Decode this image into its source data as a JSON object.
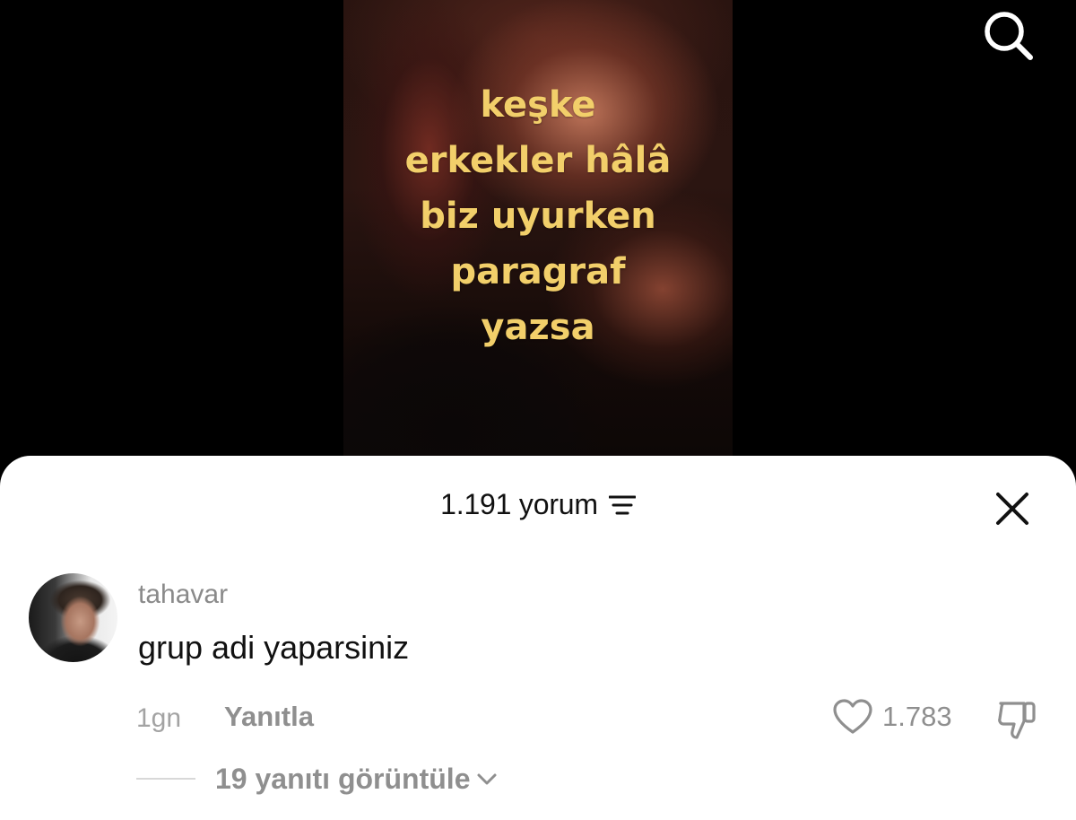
{
  "video": {
    "caption_lines": [
      "keşke",
      "erkekler hâlâ",
      "biz uyurken",
      "paragraf",
      "yazsa"
    ],
    "caption_color": "#f2cf6a"
  },
  "top_bar": {
    "search_icon": "search-icon"
  },
  "comments_sheet": {
    "count_label": "1.191 yorum",
    "sort_icon": "sort-icon",
    "close_icon": "close-icon",
    "comments": [
      {
        "username": "tahavar",
        "text": "grup adi yaparsiniz",
        "time": "1gn",
        "reply_label": "Yanıtla",
        "likes": "1.783",
        "like_icon": "heart-icon",
        "dislike_icon": "thumbs-down-icon",
        "view_replies_label": "19 yanıtı görüntüle",
        "expand_icon": "chevron-down-icon"
      }
    ]
  }
}
